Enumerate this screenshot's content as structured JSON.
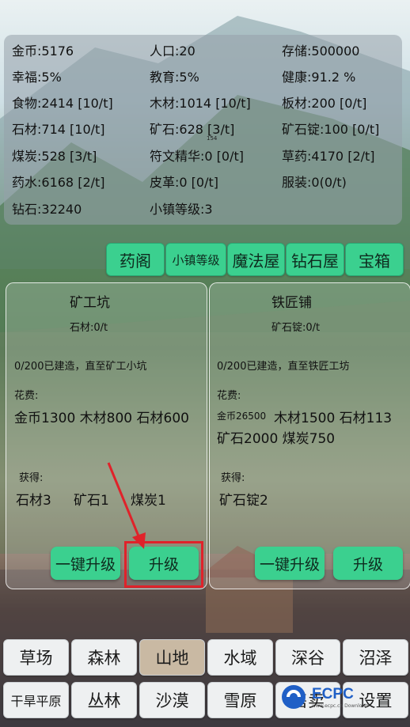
{
  "stats": {
    "r1": [
      "金币:5176",
      "人口:20",
      "存储:500000"
    ],
    "r2": [
      "幸福:5%",
      "教育:5%",
      "健康:91.2 %"
    ],
    "r3": [
      "食物:2414 [10/t]",
      "木材:1014 [10/t]",
      "板材:200 [0/t]"
    ],
    "r4": [
      "石材:714 [10/t]",
      "矿石:628 [3/t]",
      "矿石锭:100 [0/t]"
    ],
    "r5": [
      "煤炭:528 [3/t]",
      "符文精华:0 [0/t]",
      "草药:4170 [2/t]"
    ],
    "r6": [
      "药水:6168 [2/t]",
      "皮革:0 [0/t]",
      "服装:0(0/t)"
    ],
    "r7": [
      "钻石:32240",
      "小镇等级:3"
    ],
    "tiny": "154"
  },
  "tabs": [
    "药阁",
    "小镇等级",
    "魔法屋",
    "钻石屋",
    "宝箱"
  ],
  "cards": [
    {
      "title": "矿工坑",
      "rate": "石材:0/t",
      "status": "0/200已建造，直至矿工小坑",
      "cost_label": "花费:",
      "cost1": "金币1300 木材800 石材600",
      "gain_label": "获得:",
      "gains": [
        "石材3",
        "矿石1",
        "煤炭1"
      ],
      "btn_all": "一键升级",
      "btn_up": "升级"
    },
    {
      "title": "铁匠铺",
      "rate": "矿石锭:0/t",
      "status": "0/200已建造，直至铁匠工坊",
      "cost_label": "花费:",
      "cost1_small": "金币26500",
      "cost1_rest": "木材1500 石材113",
      "cost2": "矿石2000 煤炭750",
      "gain_label": "获得:",
      "gains": [
        "矿石锭2"
      ],
      "btn_all": "一键升级",
      "btn_up": "升级"
    }
  ],
  "nav": {
    "row1": [
      "草场",
      "森林",
      "山地",
      "水域",
      "深谷",
      "沼泽"
    ],
    "row2": [
      "干旱平原",
      "丛林",
      "沙漠",
      "雪原",
      "售卖",
      "设置"
    ]
  },
  "watermark": {
    "main": "ECPC",
    "sub": "www.ecpc.cn Download"
  },
  "colors": {
    "button": "#3bd08f",
    "highlight": "#e0222a",
    "selected_tab": "#c9b9a3"
  }
}
